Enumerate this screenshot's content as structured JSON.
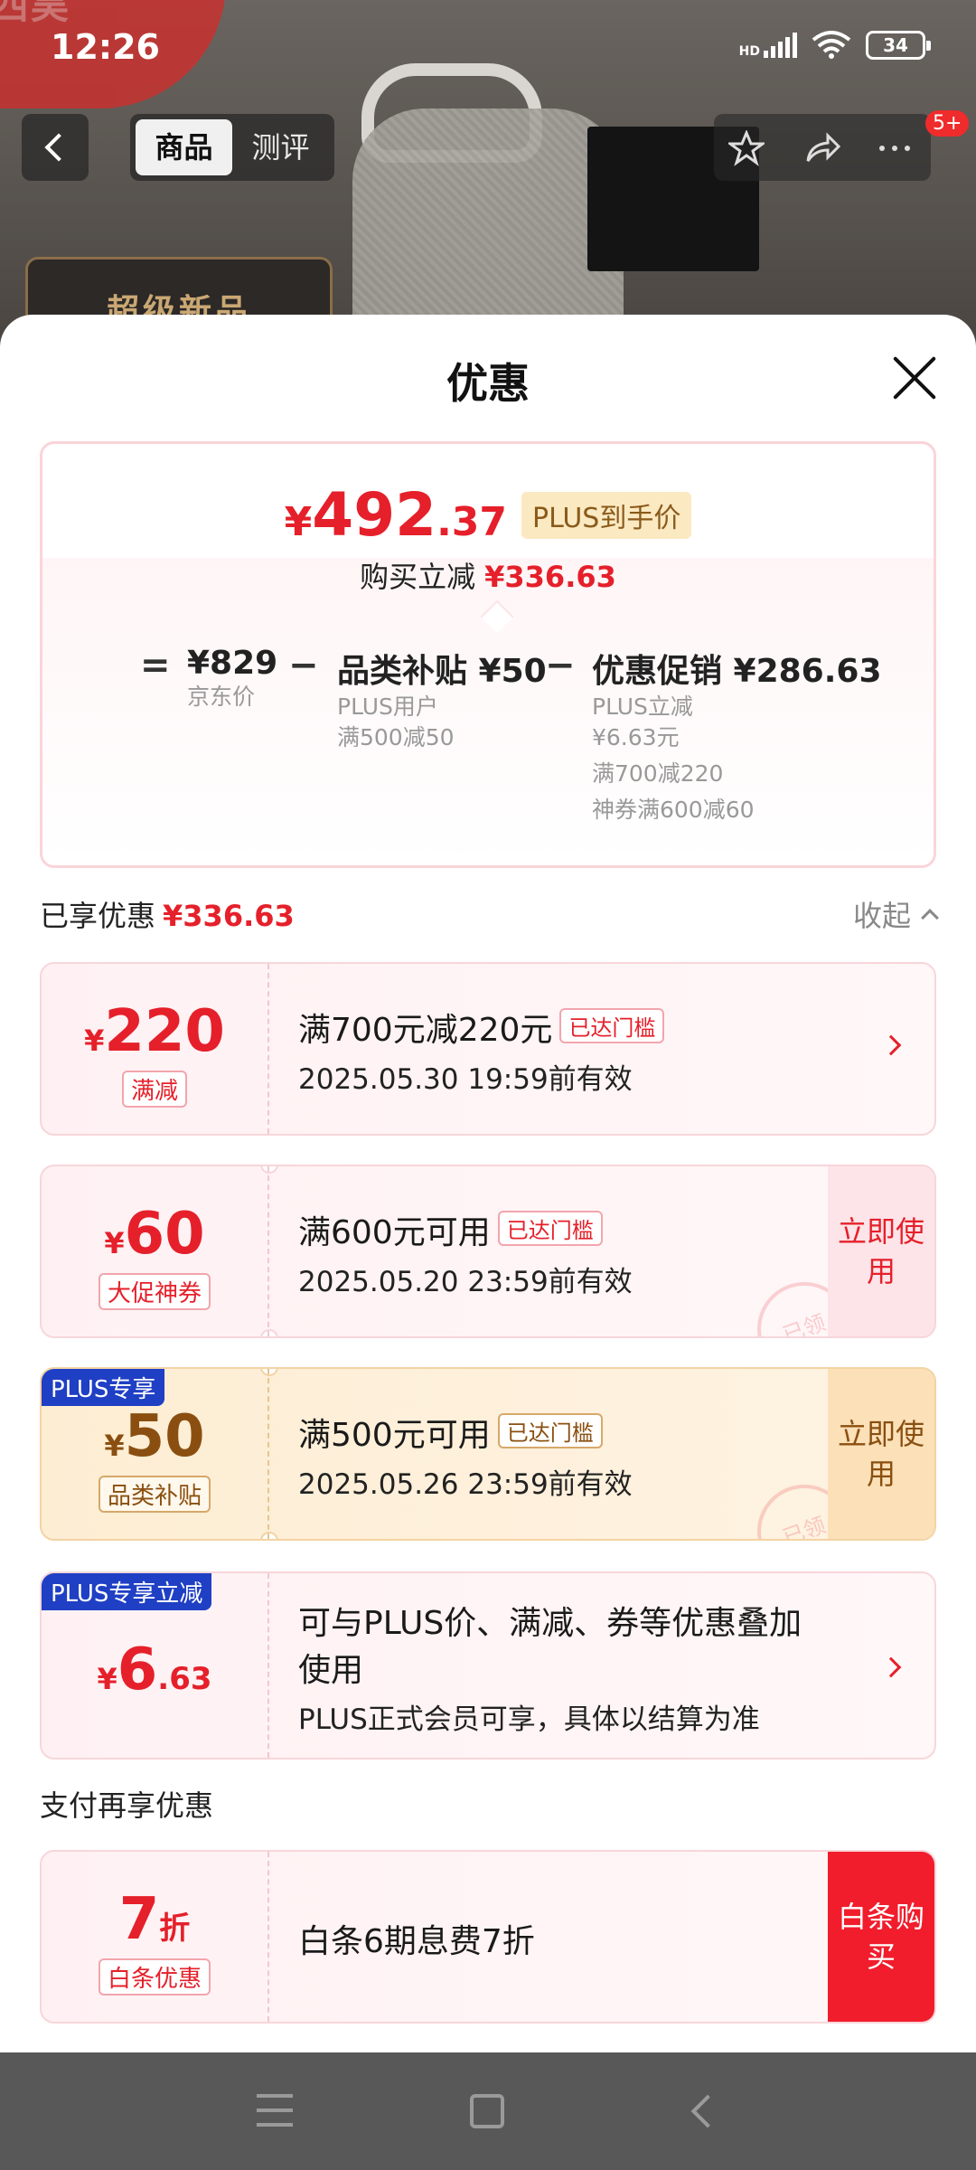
{
  "status_bar": {
    "time": "12:26",
    "network": "HD",
    "battery": "34"
  },
  "background": {
    "tabs": [
      "商品",
      "测评"
    ],
    "active_tab": "商品",
    "banner_text": "超级新品",
    "message_badge": "5+",
    "logo_text": "西昊"
  },
  "sheet": {
    "title": "优惠",
    "summary": {
      "price_symbol": "¥",
      "price_int": "492",
      "price_dec": ".37",
      "price_tag": "PLUS到手价",
      "buy_label": "购买立减",
      "buy_discount": "¥336.63",
      "equals": "=",
      "minus": "−",
      "jd_price": "¥829",
      "jd_price_label": "京东价",
      "category_subsidy": "品类补贴 ¥50",
      "category_lines": [
        "PLUS用户",
        "满500减50"
      ],
      "promotion": "优惠促销 ¥286.63",
      "promotion_lines": [
        "PLUS立减",
        "¥6.63元",
        "满700减220",
        "神券满600减60"
      ]
    },
    "enjoyed": {
      "label": "已享优惠",
      "amount": "¥336.63",
      "collapse": "收起"
    },
    "coupons": [
      {
        "symbol": "¥",
        "amount": "220",
        "decimal": "",
        "type": "满减",
        "title": "满700元减220元",
        "status": "已达门槛",
        "expiry": "2025.05.30 19:59前有效"
      },
      {
        "symbol": "¥",
        "amount": "60",
        "decimal": "",
        "type": "大促神券",
        "title": "满600元可用",
        "status": "已达门槛",
        "expiry": "2025.05.20 23:59前有效",
        "action": "立即使用",
        "stamp": "已领"
      },
      {
        "symbol": "¥",
        "amount": "50",
        "decimal": "",
        "type": "品类补贴",
        "corner": "PLUS专享",
        "title": "满500元可用",
        "status": "已达门槛",
        "expiry": "2025.05.26 23:59前有效",
        "action": "立即使用",
        "stamp": "已领"
      },
      {
        "symbol": "¥",
        "amount": "6",
        "decimal": ".63",
        "corner": "PLUS专享立减",
        "title_lines": [
          "可与PLUS价、满减、券等优惠叠加",
          "使用"
        ],
        "desc": "PLUS正式会员可享，具体以结算为准"
      }
    ],
    "pay_section": {
      "title": "支付再享优惠",
      "amount": "7",
      "unit": "折",
      "type": "白条优惠",
      "desc": "白条6期息费7折",
      "action": "白条购买"
    }
  },
  "colors": {
    "accent_red": "#e5202a",
    "gold": "#8a4f10",
    "plus_blue": "#1f3fc4"
  }
}
